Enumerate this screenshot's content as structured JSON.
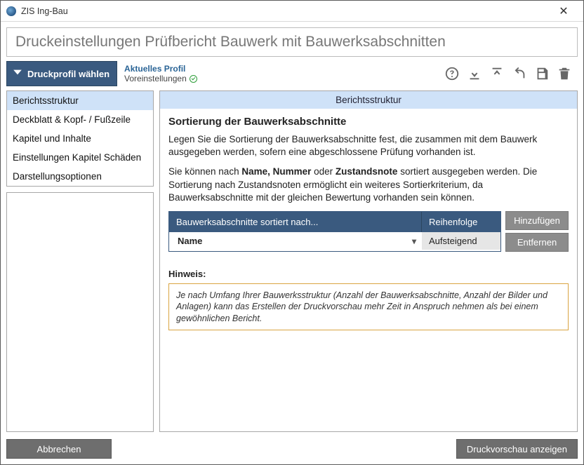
{
  "app": {
    "title": "ZIS Ing-Bau"
  },
  "header": {
    "title": "Druckeinstellungen Prüfbericht Bauwerk mit Bauwerksabschnitten"
  },
  "toolbar": {
    "profile_button": "Druckprofil wählen",
    "profile_label": "Aktuelles Profil",
    "profile_value": "Voreinstellungen"
  },
  "sidebar": {
    "items": [
      "Berichtsstruktur",
      "Deckblatt & Kopf- / Fußzeile",
      "Kapitel und Inhalte",
      "Einstellungen Kapitel Schäden",
      "Darstellungsoptionen"
    ],
    "selected_index": 0
  },
  "section": {
    "header": "Berichtsstruktur",
    "title": "Sortierung der Bauwerksabschnitte",
    "p1": "Legen Sie die Sortierung der Bauwerksabschnitte fest, die zusammen mit dem Bauwerk ausgegeben werden, sofern eine abgeschlossene Prüfung vorhanden ist.",
    "p2_a": "Sie können nach ",
    "p2_b": "Name, Nummer",
    "p2_c": " oder ",
    "p2_d": "Zustandsnote",
    "p2_e": " sortiert ausgegeben werden. Die Sortierung nach Zustandsnoten ermöglicht ein weiteres Sortierkriterium, da Bauwerksabschnitte mit der gleichen Bewertung vorhanden sein können.",
    "grid": {
      "col_sort": "Bauwerksabschnitte sortiert nach...",
      "col_order": "Reihenfolge",
      "row_sort_value": "Name",
      "row_order_value": "Aufsteigend"
    },
    "buttons": {
      "add": "Hinzufügen",
      "remove": "Entfernen"
    },
    "hint_label": "Hinweis:",
    "hint_text": "Je nach Umfang Ihrer Bauwerksstruktur (Anzahl der Bauwerksabschnitte, Anzahl der Bilder und Anlagen) kann das Erstellen der Druckvorschau mehr Zeit in Anspruch nehmen als bei einem gewöhnlichen Bericht."
  },
  "footer": {
    "cancel": "Abbrechen",
    "preview": "Druckvorschau anzeigen"
  }
}
